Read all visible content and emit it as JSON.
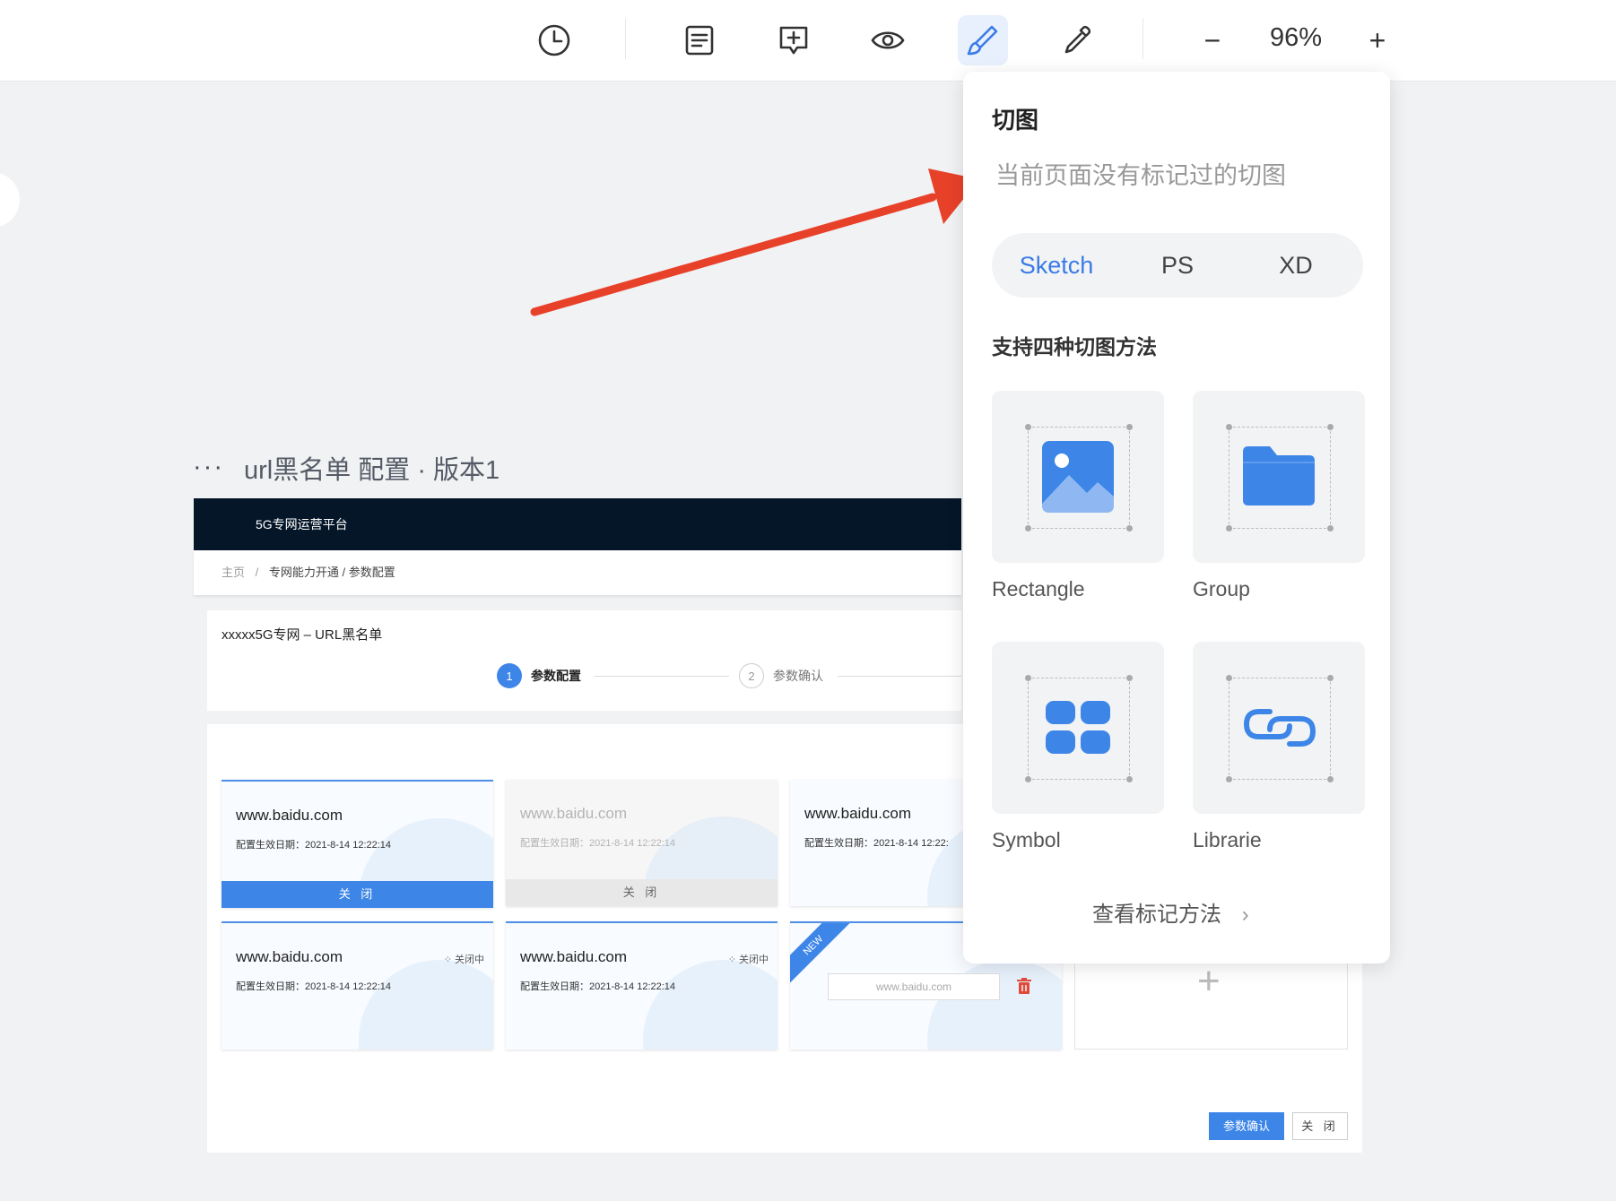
{
  "toolbar": {
    "icons": [
      "history-icon",
      "list-icon",
      "comment-add-icon",
      "eye-icon",
      "slice-brush-icon",
      "eyedropper-icon"
    ],
    "zoom_minus": "−",
    "zoom_value": "96%",
    "zoom_plus": "+"
  },
  "artboard": {
    "dots": "···",
    "title": "url黑名单 配置 · 版本1",
    "nav_title": "5G专网运营平台",
    "breadcrumb": {
      "home": "主页",
      "sep": "/",
      "path": "专网能力开通 / 参数配置"
    },
    "page_title": "xxxxx5G专网 – URL黑名单",
    "steps": [
      {
        "num": "1",
        "label": "参数配置"
      },
      {
        "num": "2",
        "label": "参数确认"
      }
    ],
    "cards": [
      {
        "url": "www.baidu.com",
        "date": "配置生效日期：2021-8-14 12:22:14",
        "bar": "关 闭"
      },
      {
        "url": "www.baidu.com",
        "date": "配置生效日期：2021-8-14 12:22:14",
        "bar": "关 闭"
      },
      {
        "url": "www.baidu.com",
        "date": "配置生效日期：2021-8-14 12:22:"
      },
      {
        "url": "www.baidu.com",
        "date": "配置生效日期：2021-8-14 12:22:14",
        "status": "关闭中"
      },
      {
        "url": "www.baidu.com",
        "date": "配置生效日期：2021-8-14 12:22:14",
        "status": "关闭中"
      }
    ],
    "new_card": {
      "ribbon": "NEW",
      "placeholder": "www.baidu.com"
    },
    "add_symbol": "+",
    "confirm_button": "参数确认",
    "close_button": "关 闭"
  },
  "panel": {
    "title": "切图",
    "empty_text": "当前页面没有标记过的切图",
    "tabs": [
      "Sketch",
      "PS",
      "XD"
    ],
    "active_tab": "Sketch",
    "subtitle": "支持四种切图方法",
    "methods": [
      "Rectangle",
      "Group",
      "Symbol",
      "Librarie"
    ],
    "link": "查看标记方法",
    "link_arrow": "›"
  },
  "colors": {
    "accent": "#3d86e8",
    "nav_bg": "#061629",
    "annotation_arrow": "#e8412a",
    "active_tool_bg": "#e8f0fd"
  }
}
